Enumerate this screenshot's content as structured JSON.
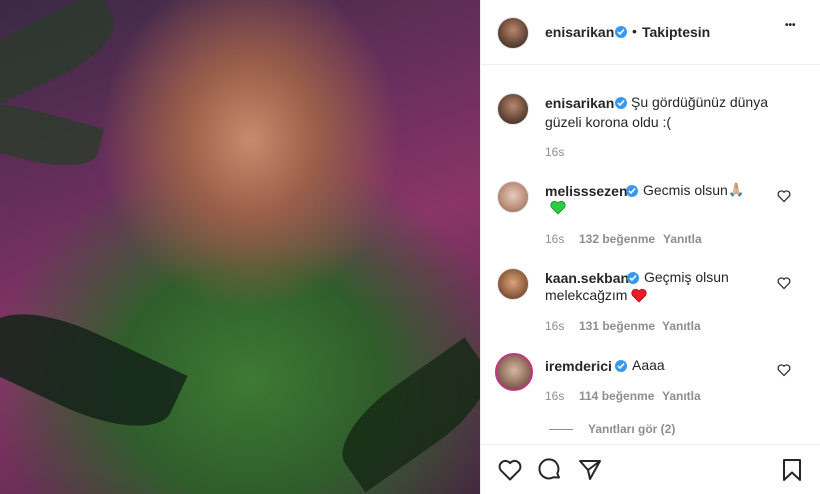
{
  "post": {
    "photo_alt": "photo",
    "author": "enisarikan",
    "follow_dot": "•",
    "follow_state": "Takiptesin",
    "more": "•••"
  },
  "caption": {
    "user": "enisarikan",
    "text_line1": "Şu gördüğünüz dünya",
    "text_line2": "güzeli korona oldu :(",
    "time": "16s"
  },
  "comments": [
    {
      "user": "melisssezen",
      "text": "Gecmis olsun",
      "emoji": "🙏🏼",
      "emoji2": "green-heart",
      "time": "16s",
      "likes": "132 beğenme",
      "reply": "Yanıtla"
    },
    {
      "user": "kaan.sekban",
      "text_line1": "Geçmiş olsun",
      "text_line2": "melekcağzım",
      "emoji": "red-heart",
      "time": "16s",
      "likes": "131 beğenme",
      "reply": "Yanıtla"
    },
    {
      "user": "iremderici",
      "text": "Aaaa",
      "time": "16s",
      "likes": "114 beğenme",
      "reply": "Yanıtla",
      "view_replies": "Yanıtları gör (2)"
    }
  ],
  "colors": {
    "verified": "#3897f0",
    "muted": "#8e8e8e",
    "text": "#262626",
    "green_heart": "#2ecc40",
    "red_heart": "#ed1c24"
  }
}
